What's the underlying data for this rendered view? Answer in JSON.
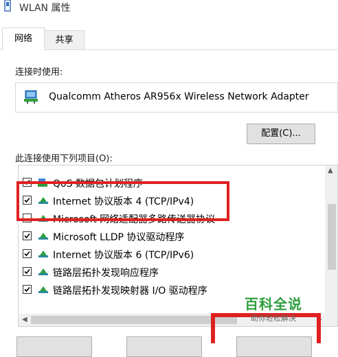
{
  "window": {
    "title": "WLAN 属性"
  },
  "tabs": [
    {
      "label": "网络",
      "active": true
    },
    {
      "label": "共享",
      "active": false
    }
  ],
  "connect_using_label": "连接时使用:",
  "adapter": {
    "name": "Qualcomm Atheros AR956x Wireless Network Adapter",
    "icon": "network-adapter-icon"
  },
  "configure_button": "配置(C)...",
  "items_label": "此连接使用下列项目(O):",
  "items": [
    {
      "label": "QoS 数据包计划程序",
      "checked": true,
      "icon": "network-component-icon"
    },
    {
      "label": "Internet 协议版本 4 (TCP/IPv4)",
      "checked": true,
      "icon": "protocol-icon"
    },
    {
      "label": "Microsoft 网络适配器多路传送器协议",
      "checked": false,
      "icon": "protocol-icon"
    },
    {
      "label": "Microsoft LLDP 协议驱动程序",
      "checked": true,
      "icon": "protocol-icon"
    },
    {
      "label": "Internet 协议版本 6 (TCP/IPv6)",
      "checked": true,
      "icon": "protocol-icon"
    },
    {
      "label": "链路层拓扑发现响应程序",
      "checked": true,
      "icon": "protocol-icon"
    },
    {
      "label": "链路层拓扑发现映射器 I/O 驱动程序",
      "checked": true,
      "icon": "protocol-icon"
    }
  ],
  "watermark": {
    "title": "百科全说",
    "subtitle": "助你轻松解决"
  },
  "colors": {
    "highlight": "#e02020",
    "watermark": "#2e9e3e"
  }
}
